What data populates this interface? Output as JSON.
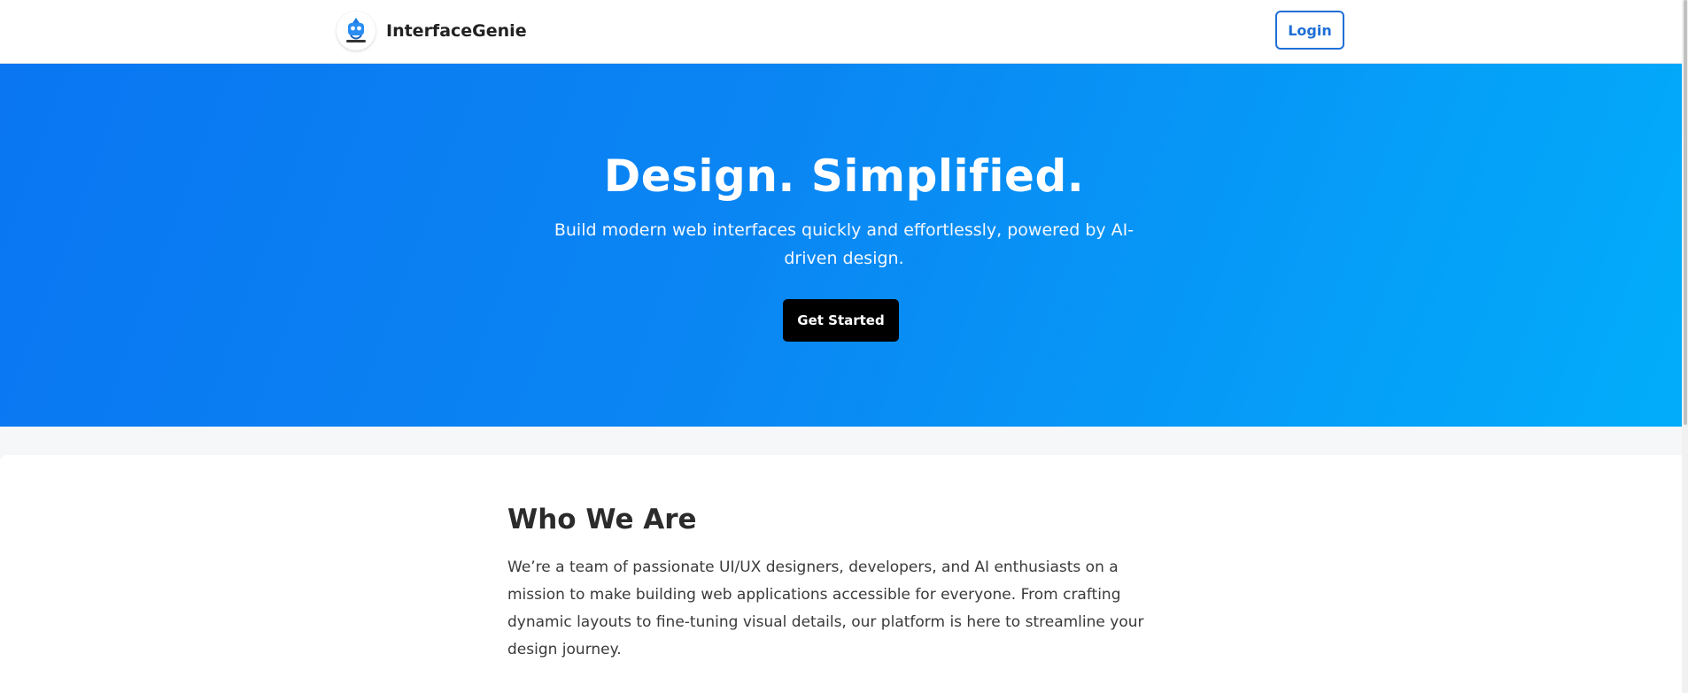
{
  "header": {
    "brand_name": "InterfaceGenie",
    "login_label": "Login"
  },
  "hero": {
    "title": "Design. Simplified.",
    "subtitle": "Build modern web interfaces quickly and effortlessly, powered by AI-driven design.",
    "cta_label": "Get Started"
  },
  "about": {
    "title": "Who We Are",
    "body": "We’re a team of passionate UI/UX designers, developers, and AI enthusiasts on a mission to make building web applications accessible for everyone. From crafting dynamic layouts to fine-tuning visual details, our platform is here to streamline your design journey."
  },
  "colors": {
    "accent": "#1f6fd6",
    "hero_gradient_start": "#0a76f2",
    "hero_gradient_end": "#02adfb",
    "cta_background": "#000000"
  },
  "icons": {
    "logo": "genie-logo-icon"
  }
}
